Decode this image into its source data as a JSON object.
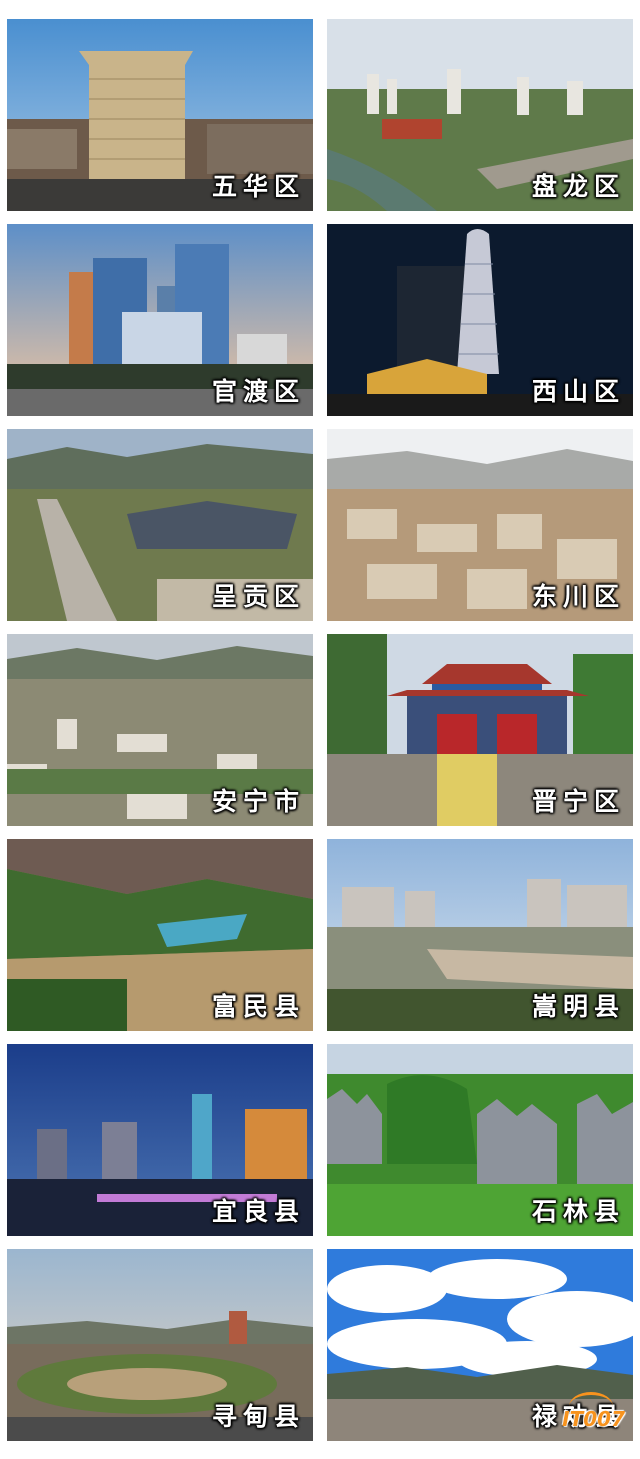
{
  "tiles": [
    {
      "label": "五华区"
    },
    {
      "label": "盘龙区"
    },
    {
      "label": "官渡区"
    },
    {
      "label": "西山区"
    },
    {
      "label": "呈贡区"
    },
    {
      "label": "东川区"
    },
    {
      "label": "安宁市"
    },
    {
      "label": "晋宁区"
    },
    {
      "label": "富民县"
    },
    {
      "label": "嵩明县"
    },
    {
      "label": "宜良县"
    },
    {
      "label": "石林县"
    },
    {
      "label": "寻甸县"
    },
    {
      "label": "禄劝县"
    }
  ],
  "watermark": "IT007",
  "colors": {
    "label_text": "#ffffff",
    "watermark": "#f7931e"
  }
}
